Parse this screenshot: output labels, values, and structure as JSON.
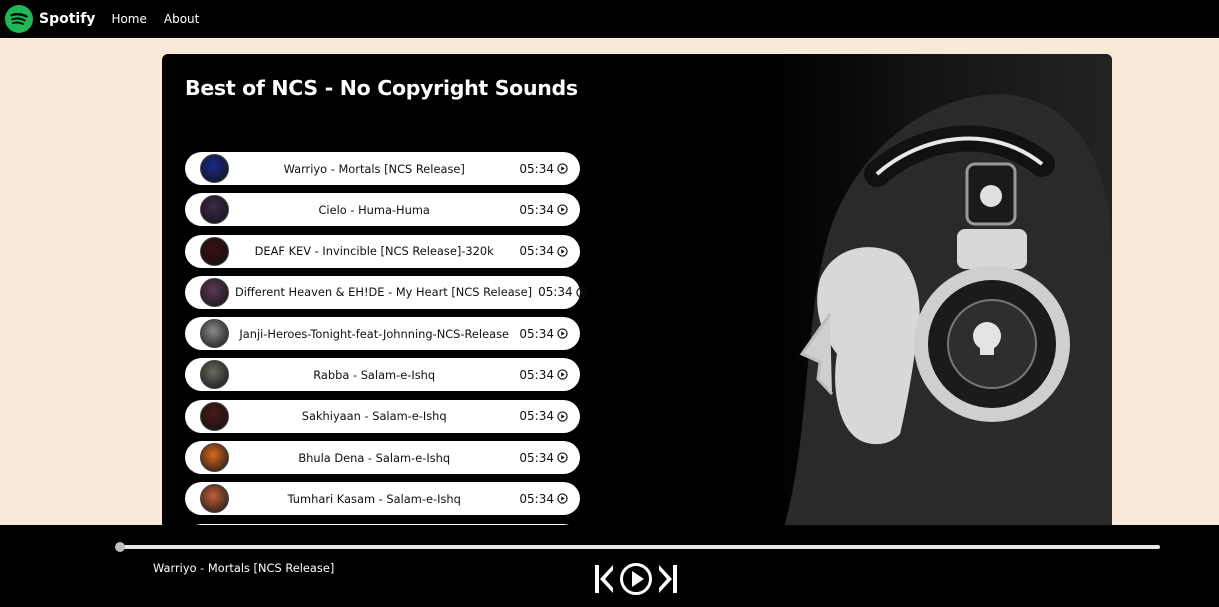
{
  "navbar": {
    "brand": "Spotify",
    "logo_icon": "spotify-logo-icon",
    "links": [
      "Home",
      "About"
    ]
  },
  "playlist": {
    "title": "Best of NCS - No Copyright Sounds",
    "songs": [
      {
        "name": "Warriyo - Mortals [NCS Release]",
        "duration": "05:34",
        "cover_color": "#1a2a8a"
      },
      {
        "name": "Cielo - Huma-Huma",
        "duration": "05:34",
        "cover_color": "#3a2a4a"
      },
      {
        "name": "DEAF KEV - Invincible [NCS Release]-320k",
        "duration": "05:34",
        "cover_color": "#3a1010"
      },
      {
        "name": "Different Heaven & EH!DE - My Heart [NCS Release]",
        "duration": "05:34",
        "cover_color": "#5a3a55"
      },
      {
        "name": "Janji-Heroes-Tonight-feat-Johnning-NCS-Release",
        "duration": "05:34",
        "cover_color": "#8a8a8a"
      },
      {
        "name": "Rabba - Salam-e-Ishq",
        "duration": "05:34",
        "cover_color": "#6a6a60"
      },
      {
        "name": "Sakhiyaan - Salam-e-Ishq",
        "duration": "05:34",
        "cover_color": "#4a1a1a"
      },
      {
        "name": "Bhula Dena - Salam-e-Ishq",
        "duration": "05:34",
        "cover_color": "#d86a20"
      },
      {
        "name": "Tumhari Kasam - Salam-e-Ishq",
        "duration": "05:34",
        "cover_color": "#c0603a"
      }
    ]
  },
  "player": {
    "now_playing": "Warriyo - Mortals [NCS Release]",
    "progress_fraction": 0.0,
    "icons": [
      "previous-icon",
      "play-icon",
      "next-icon"
    ]
  },
  "colors": {
    "page_background": "#fbe9d7",
    "bars": "#000000",
    "accent": "#1db954"
  }
}
